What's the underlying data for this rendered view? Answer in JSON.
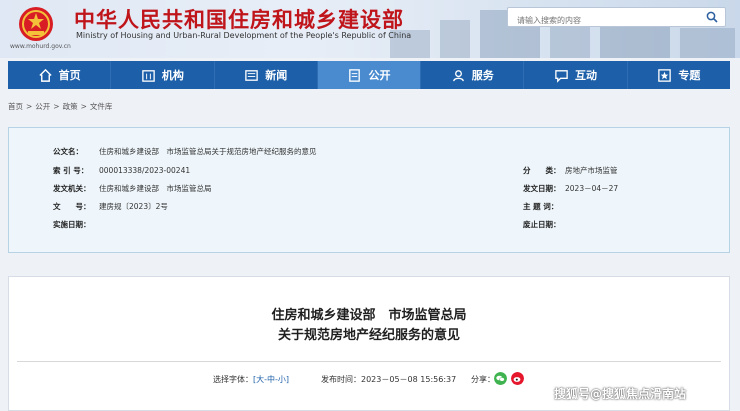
{
  "header": {
    "title": "中华人民共和国住房和城乡建设部",
    "subtitle": "Ministry of Housing and Urban-Rural Development of the People's Republic of China",
    "domain": "www.mohurd.gov.cn",
    "search_placeholder": "请输入搜索的内容"
  },
  "nav": {
    "items": [
      {
        "label": "首页",
        "icon": "home-icon"
      },
      {
        "label": "机构",
        "icon": "building-icon"
      },
      {
        "label": "新闻",
        "icon": "news-icon"
      },
      {
        "label": "公开",
        "icon": "public-icon"
      },
      {
        "label": "服务",
        "icon": "service-icon"
      },
      {
        "label": "互动",
        "icon": "interaction-icon"
      },
      {
        "label": "专题",
        "icon": "topic-icon"
      }
    ],
    "active": "公开",
    "colors": {
      "bar": "#1d5fa8",
      "active": "#4a8bd0"
    }
  },
  "breadcrumb": [
    "首页",
    "公开",
    "政策",
    "文件库"
  ],
  "info": {
    "gongwen": {
      "label": "公文名：",
      "value": "住房和城乡建设部　市场监管总局关于规范房地产经纪服务的意见"
    },
    "suoyin": {
      "label": "索 引 号：",
      "value": "000013338/2023-00241"
    },
    "fenlei": {
      "label": "分　　类：",
      "value": "房地产市场监管"
    },
    "fawen_jiguan": {
      "label": "发文机关：",
      "value": "住房和城乡建设部　市场监管总局"
    },
    "fawen_riqi": {
      "label": "发文日期：",
      "value": "2023－04－27"
    },
    "wenhao": {
      "label": "文　　号：",
      "value": "建房规〔2023〕2号"
    },
    "zhuti": {
      "label": "主 题 词：",
      "value": ""
    },
    "shishi": {
      "label": "实施日期：",
      "value": ""
    },
    "feizhi": {
      "label": "废止日期：",
      "value": ""
    }
  },
  "article": {
    "title_line1": "住房和城乡建设部　市场监管总局",
    "title_line2": "关于规范房地产经纪服务的意见",
    "font_label": "选择字体：",
    "font_open": "[",
    "font_big": "大",
    "font_mid": "中",
    "font_small": "小",
    "font_close": "]",
    "dash": "-",
    "publish_label": "发布时间：",
    "publish_time": "2023－05－08 15:56:37",
    "share_label": "分享：",
    "share_icons": [
      "wechat-icon",
      "weibo-icon"
    ]
  },
  "watermark": "搜狐号@搜狐焦点滑南站"
}
